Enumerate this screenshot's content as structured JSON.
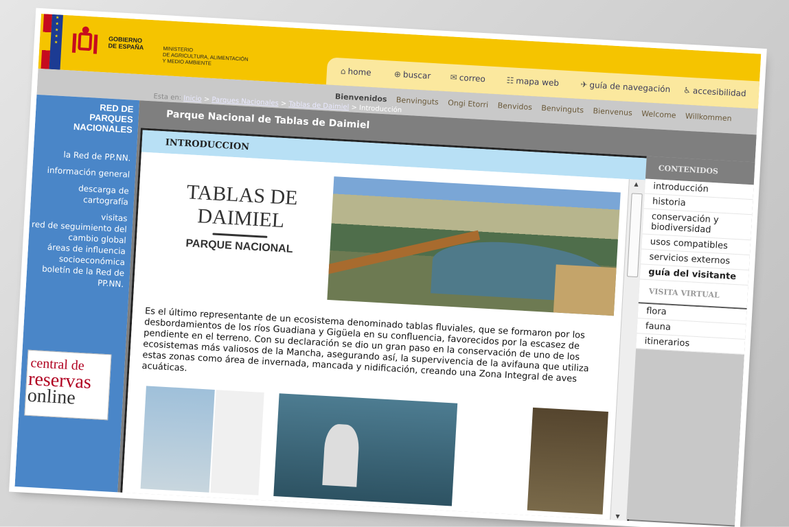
{
  "header": {
    "gobierno": [
      "GOBIERNO",
      "DE ESPAÑA"
    ],
    "ministerio": [
      "MINISTERIO",
      "DE AGRICULTURA, ALIMENTACIÓN",
      "Y MEDIO AMBIENTE"
    ]
  },
  "toolbar": {
    "home": "home",
    "buscar": "buscar",
    "correo": "correo",
    "mapa_web": "mapa web",
    "guia": "guía de navegación",
    "accesibilidad": "accesibilidad"
  },
  "languages": [
    "Bienvenidos",
    "Benvinguts",
    "Ongi Etorri",
    "Benvidos",
    "Benvinguts",
    "Bienvenus",
    "Welcome",
    "Willkommen"
  ],
  "breadcrumb": {
    "label": "Esta en:",
    "inicio": "Inicio",
    "parques": "Parques Nacionales",
    "tablas": "Tablas de Daimiel",
    "current": "Introducción",
    "sep": ">"
  },
  "sidebar": {
    "title": [
      "RED DE",
      "PARQUES",
      "NACIONALES"
    ],
    "items": [
      "la Red de PP.NN.",
      "información general",
      "descarga de cartografía",
      "visitas",
      "red de seguimiento del cambio global",
      "áreas de influencia socioeconómica",
      "boletín de la Red de PP.NN."
    ],
    "reservas": [
      "central de",
      "reservas",
      "online"
    ]
  },
  "main": {
    "park_title": "Parque Nacional de Tablas de Daimiel",
    "section": "INTRODUCCION",
    "logo": [
      "TABLAS DE",
      "DAIMIEL",
      "PARQUE NACIONAL"
    ],
    "paragraph": "Es el último representante de un ecosistema denominado tablas fluviales, que se formaron por los desbordamientos de los ríos Guadiana y Gigüela en su confluencia, favorecidos por la escasez de pendiente en el terreno. Con su declaración se dio un gran paso en la conservación de uno de los ecosistemas más valiosos de la Mancha, asegurando así, la supervivencia de la avifauna que utiliza estas zonas como área de invernada, mancada y nidificación, creando una Zona Integral de aves acuáticas."
  },
  "right": {
    "contenidos_title": "CONTENIDOS",
    "contenidos": [
      "introducción",
      "historia",
      "conservación y biodiversidad",
      "usos compatibles",
      "servicios externos",
      "guía del visitante"
    ],
    "visita_title": "VISITA VIRTUAL",
    "visita": [
      "flora",
      "fauna",
      "itinerarios"
    ]
  },
  "colors": {
    "header_yellow": "#f5c400",
    "sidebar_blue": "#4a86c8",
    "section_bar": "#b8e0f5"
  }
}
